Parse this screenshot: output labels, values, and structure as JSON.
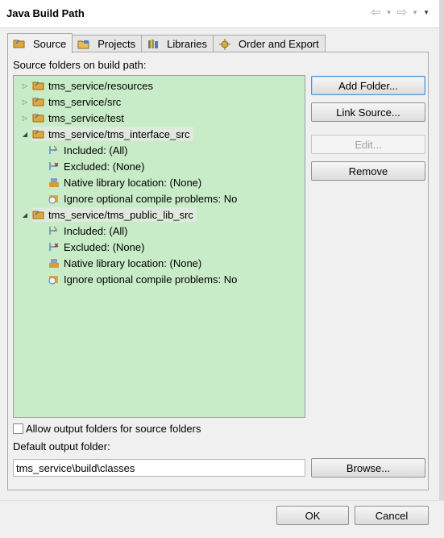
{
  "window": {
    "title": "Java Build Path",
    "nav_back": "⇦",
    "nav_forward": "⇨",
    "nav_dropdown": "▼"
  },
  "tabs": [
    {
      "label": "Source",
      "icon": "source-folder-icon",
      "active": true
    },
    {
      "label": "Projects",
      "icon": "projects-icon"
    },
    {
      "label": "Libraries",
      "icon": "libraries-icon"
    },
    {
      "label": "Order and Export",
      "icon": "order-export-icon"
    }
  ],
  "source": {
    "tree_label": "Source folders on build path:",
    "tree": [
      {
        "label": "tms_service/resources",
        "expanded": false,
        "level": 0
      },
      {
        "label": "tms_service/src",
        "expanded": false,
        "level": 0
      },
      {
        "label": "tms_service/test",
        "expanded": false,
        "level": 0
      },
      {
        "label": "tms_service/tms_interface_src",
        "expanded": true,
        "level": 0,
        "selected": true
      },
      {
        "label": "Included: (All)",
        "level": 1,
        "icon": "included-icon"
      },
      {
        "label": "Excluded: (None)",
        "level": 1,
        "icon": "excluded-icon"
      },
      {
        "label": "Native library location: (None)",
        "level": 1,
        "icon": "native-library-icon"
      },
      {
        "label": "Ignore optional compile problems: No",
        "level": 1,
        "icon": "ignore-problems-icon"
      },
      {
        "label": "tms_service/tms_public_lib_src",
        "expanded": true,
        "level": 0,
        "selected": true
      },
      {
        "label": "Included: (All)",
        "level": 1,
        "icon": "included-icon"
      },
      {
        "label": "Excluded: (None)",
        "level": 1,
        "icon": "excluded-icon"
      },
      {
        "label": "Native library location: (None)",
        "level": 1,
        "icon": "native-library-icon"
      },
      {
        "label": "Ignore optional compile problems: No",
        "level": 1,
        "icon": "ignore-problems-icon"
      }
    ],
    "buttons": {
      "add_folder": "Add Folder...",
      "link_source": "Link Source...",
      "edit": "Edit...",
      "remove": "Remove"
    },
    "allow_output_label": "Allow output folders for source folders",
    "default_output_label": "Default output folder:",
    "default_output_value": "tms_service\\build\\classes",
    "browse": "Browse..."
  },
  "footer": {
    "ok": "OK",
    "cancel": "Cancel"
  },
  "colors": {
    "tree_background": "#c8ebc8",
    "folder": "#e3a53a",
    "primary_focus": "#4e8fd3"
  }
}
